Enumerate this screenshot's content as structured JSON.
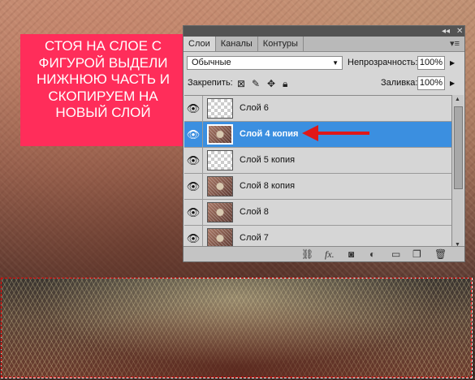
{
  "instruction": "СТОЯ НА СЛОЕ С ФИГУРОЙ ВЫДЕЛИ НИЖНЮЮ ЧАСТЬ И СКОПИРУЕМ НА НОВЫЙ СЛОЙ",
  "panel": {
    "tabs": [
      "Слои",
      "Каналы",
      "Контуры"
    ],
    "blend_mode": "Обычные",
    "opacity_label": "Непрозрачность:",
    "opacity_value": "100%",
    "lock_label": "Закрепить:",
    "fill_label": "Заливка:",
    "fill_value": "100%",
    "layers": [
      {
        "name": "Слой 6",
        "thumb": "transparent",
        "selected": false
      },
      {
        "name": "Слой 4 копия",
        "thumb": "art",
        "selected": true
      },
      {
        "name": "Слой 5 копия",
        "thumb": "transparent",
        "selected": false
      },
      {
        "name": "Слой 8 копия",
        "thumb": "art",
        "selected": false
      },
      {
        "name": "Слой 8",
        "thumb": "art",
        "selected": false
      },
      {
        "name": "Слой 7",
        "thumb": "art",
        "selected": false
      }
    ],
    "bottom_icons": [
      "link-icon",
      "fx-icon",
      "mask-icon",
      "adjustment-icon",
      "folder-icon",
      "new-layer-icon",
      "trash-icon"
    ]
  },
  "colors": {
    "note_bg": "#ff2d5a",
    "selection": "#3b8fe0",
    "arrow": "#e01818"
  }
}
